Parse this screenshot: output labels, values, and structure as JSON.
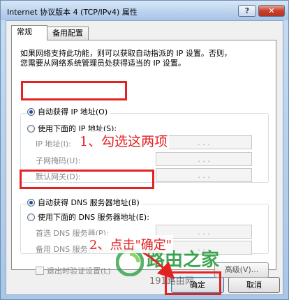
{
  "window": {
    "title": "Internet 协议版本 4 (TCP/IPv4) 属性",
    "help_label": "?",
    "close_label": "✕"
  },
  "tabs": [
    {
      "label": "常规",
      "active": true
    },
    {
      "label": "备用配置",
      "active": false
    }
  ],
  "description": [
    "如果网络支持此功能，则可以获取自动指派的 IP 设置。否则，",
    "您需要从网络系统管理员处获得适当的 IP 设置。"
  ],
  "ip_section": {
    "auto_label": "自动获得 IP 地址(O)",
    "auto_checked": true,
    "manual_label": "使用下面的 IP 地址(S):",
    "fields": [
      {
        "label": "IP 地址(I):",
        "value": ". . ."
      },
      {
        "label": "子网掩码(U):",
        "value": ". . ."
      },
      {
        "label": "默认网关(D):",
        "value": ". . ."
      }
    ]
  },
  "dns_section": {
    "auto_label": "自动获得 DNS 服务器地址(B)",
    "auto_checked": true,
    "manual_label": "使用下面的 DNS 服务器地址(E):",
    "fields": [
      {
        "label": "首选 DNS 服务器(P):",
        "value": ". . ."
      },
      {
        "label": "备用 DNS 服务器(A):",
        "value": ". . ."
      }
    ]
  },
  "validate_label": "退出时验证设置(L)",
  "advanced_label": "高级(V)...",
  "buttons": {
    "ok_label": "确定",
    "cancel_label": "取消"
  },
  "annotations": {
    "step1": "1、勾选这两项",
    "step2": "2、点击\"确定\"",
    "color": "#e32222"
  },
  "watermark": {
    "text_cn": "路由之家",
    "url": "191路由网",
    "color": "#1c9634"
  }
}
